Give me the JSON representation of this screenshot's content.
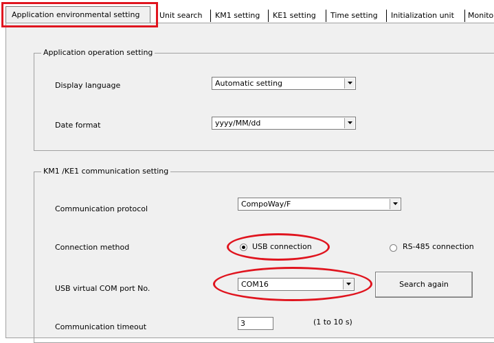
{
  "tabs": [
    {
      "label": "Application environmental setting",
      "active": true
    },
    {
      "label": "Unit search"
    },
    {
      "label": "KM1 setting"
    },
    {
      "label": "KE1 setting"
    },
    {
      "label": "Time setting"
    },
    {
      "label": "Initialization unit"
    },
    {
      "label": "Monito"
    }
  ],
  "app_operation": {
    "title": "Application operation setting",
    "display_language": {
      "label": "Display language",
      "value": "Automatic setting"
    },
    "date_format": {
      "label": "Date format",
      "value": "yyyy/MM/dd"
    }
  },
  "communication": {
    "title": "KM1 /KE1 communication setting",
    "protocol": {
      "label": "Communication protocol",
      "value": "CompoWay/F"
    },
    "connection": {
      "label": "Connection method",
      "usb": "USB connection",
      "rs485": "RS-485 connection",
      "selected": "usb"
    },
    "com_port": {
      "label": "USB virtual COM port No.",
      "value": "COM16",
      "search_button": "Search again"
    },
    "timeout": {
      "label": "Communication timeout",
      "value": "3",
      "hint": "(1 to 10 s)"
    }
  },
  "colors": {
    "highlight": "#e0141e",
    "panel": "#f0f0f0"
  }
}
